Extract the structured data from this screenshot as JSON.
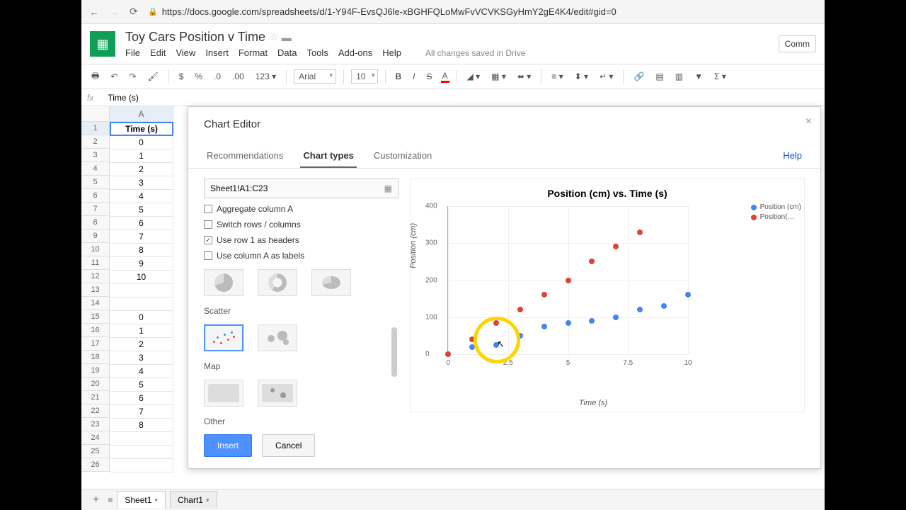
{
  "browser": {
    "url": "https://docs.google.com/spreadsheets/d/1-Y94F-EvsQJ6le-xBGHFQLoMwFvVCVKSGyHmY2gE4K4/edit#gid=0"
  },
  "doc": {
    "title": "Toy Cars Position v Time"
  },
  "menu": {
    "file": "File",
    "edit": "Edit",
    "view": "View",
    "insert": "Insert",
    "format": "Format",
    "data": "Data",
    "tools": "Tools",
    "addons": "Add-ons",
    "help": "Help",
    "saved": "All changes saved in Drive",
    "comment": "Comm"
  },
  "toolbar": {
    "font": "Arial",
    "size": "10",
    "currency": "$",
    "percent": "%",
    "dec0": ".0",
    "dec00": ".00",
    "num": "123"
  },
  "fx": {
    "label": "fx",
    "value": "Time (s)"
  },
  "colA_header": "A",
  "rows": [
    {
      "n": "1",
      "v": "Time (s)"
    },
    {
      "n": "2",
      "v": "0"
    },
    {
      "n": "3",
      "v": "1"
    },
    {
      "n": "4",
      "v": "2"
    },
    {
      "n": "5",
      "v": "3"
    },
    {
      "n": "6",
      "v": "4"
    },
    {
      "n": "7",
      "v": "5"
    },
    {
      "n": "8",
      "v": "6"
    },
    {
      "n": "9",
      "v": "7"
    },
    {
      "n": "10",
      "v": "8"
    },
    {
      "n": "11",
      "v": "9"
    },
    {
      "n": "12",
      "v": "10"
    },
    {
      "n": "13",
      "v": ""
    },
    {
      "n": "14",
      "v": ""
    },
    {
      "n": "15",
      "v": "0"
    },
    {
      "n": "16",
      "v": "1"
    },
    {
      "n": "17",
      "v": "2"
    },
    {
      "n": "18",
      "v": "3"
    },
    {
      "n": "19",
      "v": "4"
    },
    {
      "n": "20",
      "v": "5"
    },
    {
      "n": "21",
      "v": "6"
    },
    {
      "n": "22",
      "v": "7"
    },
    {
      "n": "23",
      "v": "8"
    },
    {
      "n": "24",
      "v": ""
    },
    {
      "n": "25",
      "v": ""
    },
    {
      "n": "26",
      "v": ""
    }
  ],
  "dialog": {
    "title": "Chart Editor",
    "tabs": {
      "rec": "Recommendations",
      "types": "Chart types",
      "custom": "Customization"
    },
    "help": "Help",
    "range": "Sheet1!A1:C23",
    "opts": {
      "agg": "Aggregate column A",
      "switch": "Switch rows / columns",
      "row1": "Use row 1 as headers",
      "colA": "Use column A as labels"
    },
    "sections": {
      "scatter": "Scatter",
      "map": "Map",
      "other": "Other"
    },
    "buttons": {
      "insert": "Insert",
      "cancel": "Cancel"
    }
  },
  "chart_data": {
    "type": "scatter",
    "title": "Position (cm) vs. Time (s)",
    "xlabel": "Time (s)",
    "ylabel": "Position (cm)",
    "xlim": [
      0,
      10
    ],
    "ylim": [
      0,
      400
    ],
    "xticks": [
      0,
      2.5,
      5,
      7.5,
      10
    ],
    "yticks": [
      0,
      100,
      200,
      300,
      400
    ],
    "series": [
      {
        "name": "Position (cm)",
        "color": "#4285f4",
        "x": [
          0,
          1,
          2,
          3,
          4,
          5,
          6,
          7,
          8,
          9,
          10
        ],
        "y": [
          0,
          20,
          25,
          50,
          75,
          85,
          90,
          100,
          120,
          130,
          160
        ]
      },
      {
        "name": "Position(…",
        "color": "#db4437",
        "x": [
          0,
          1,
          2,
          3,
          4,
          5,
          6,
          7,
          8
        ],
        "y": [
          0,
          40,
          85,
          120,
          160,
          200,
          250,
          290,
          330
        ]
      }
    ]
  },
  "sheets": {
    "add": "+",
    "s1": "Sheet1",
    "s2": "Chart1"
  }
}
